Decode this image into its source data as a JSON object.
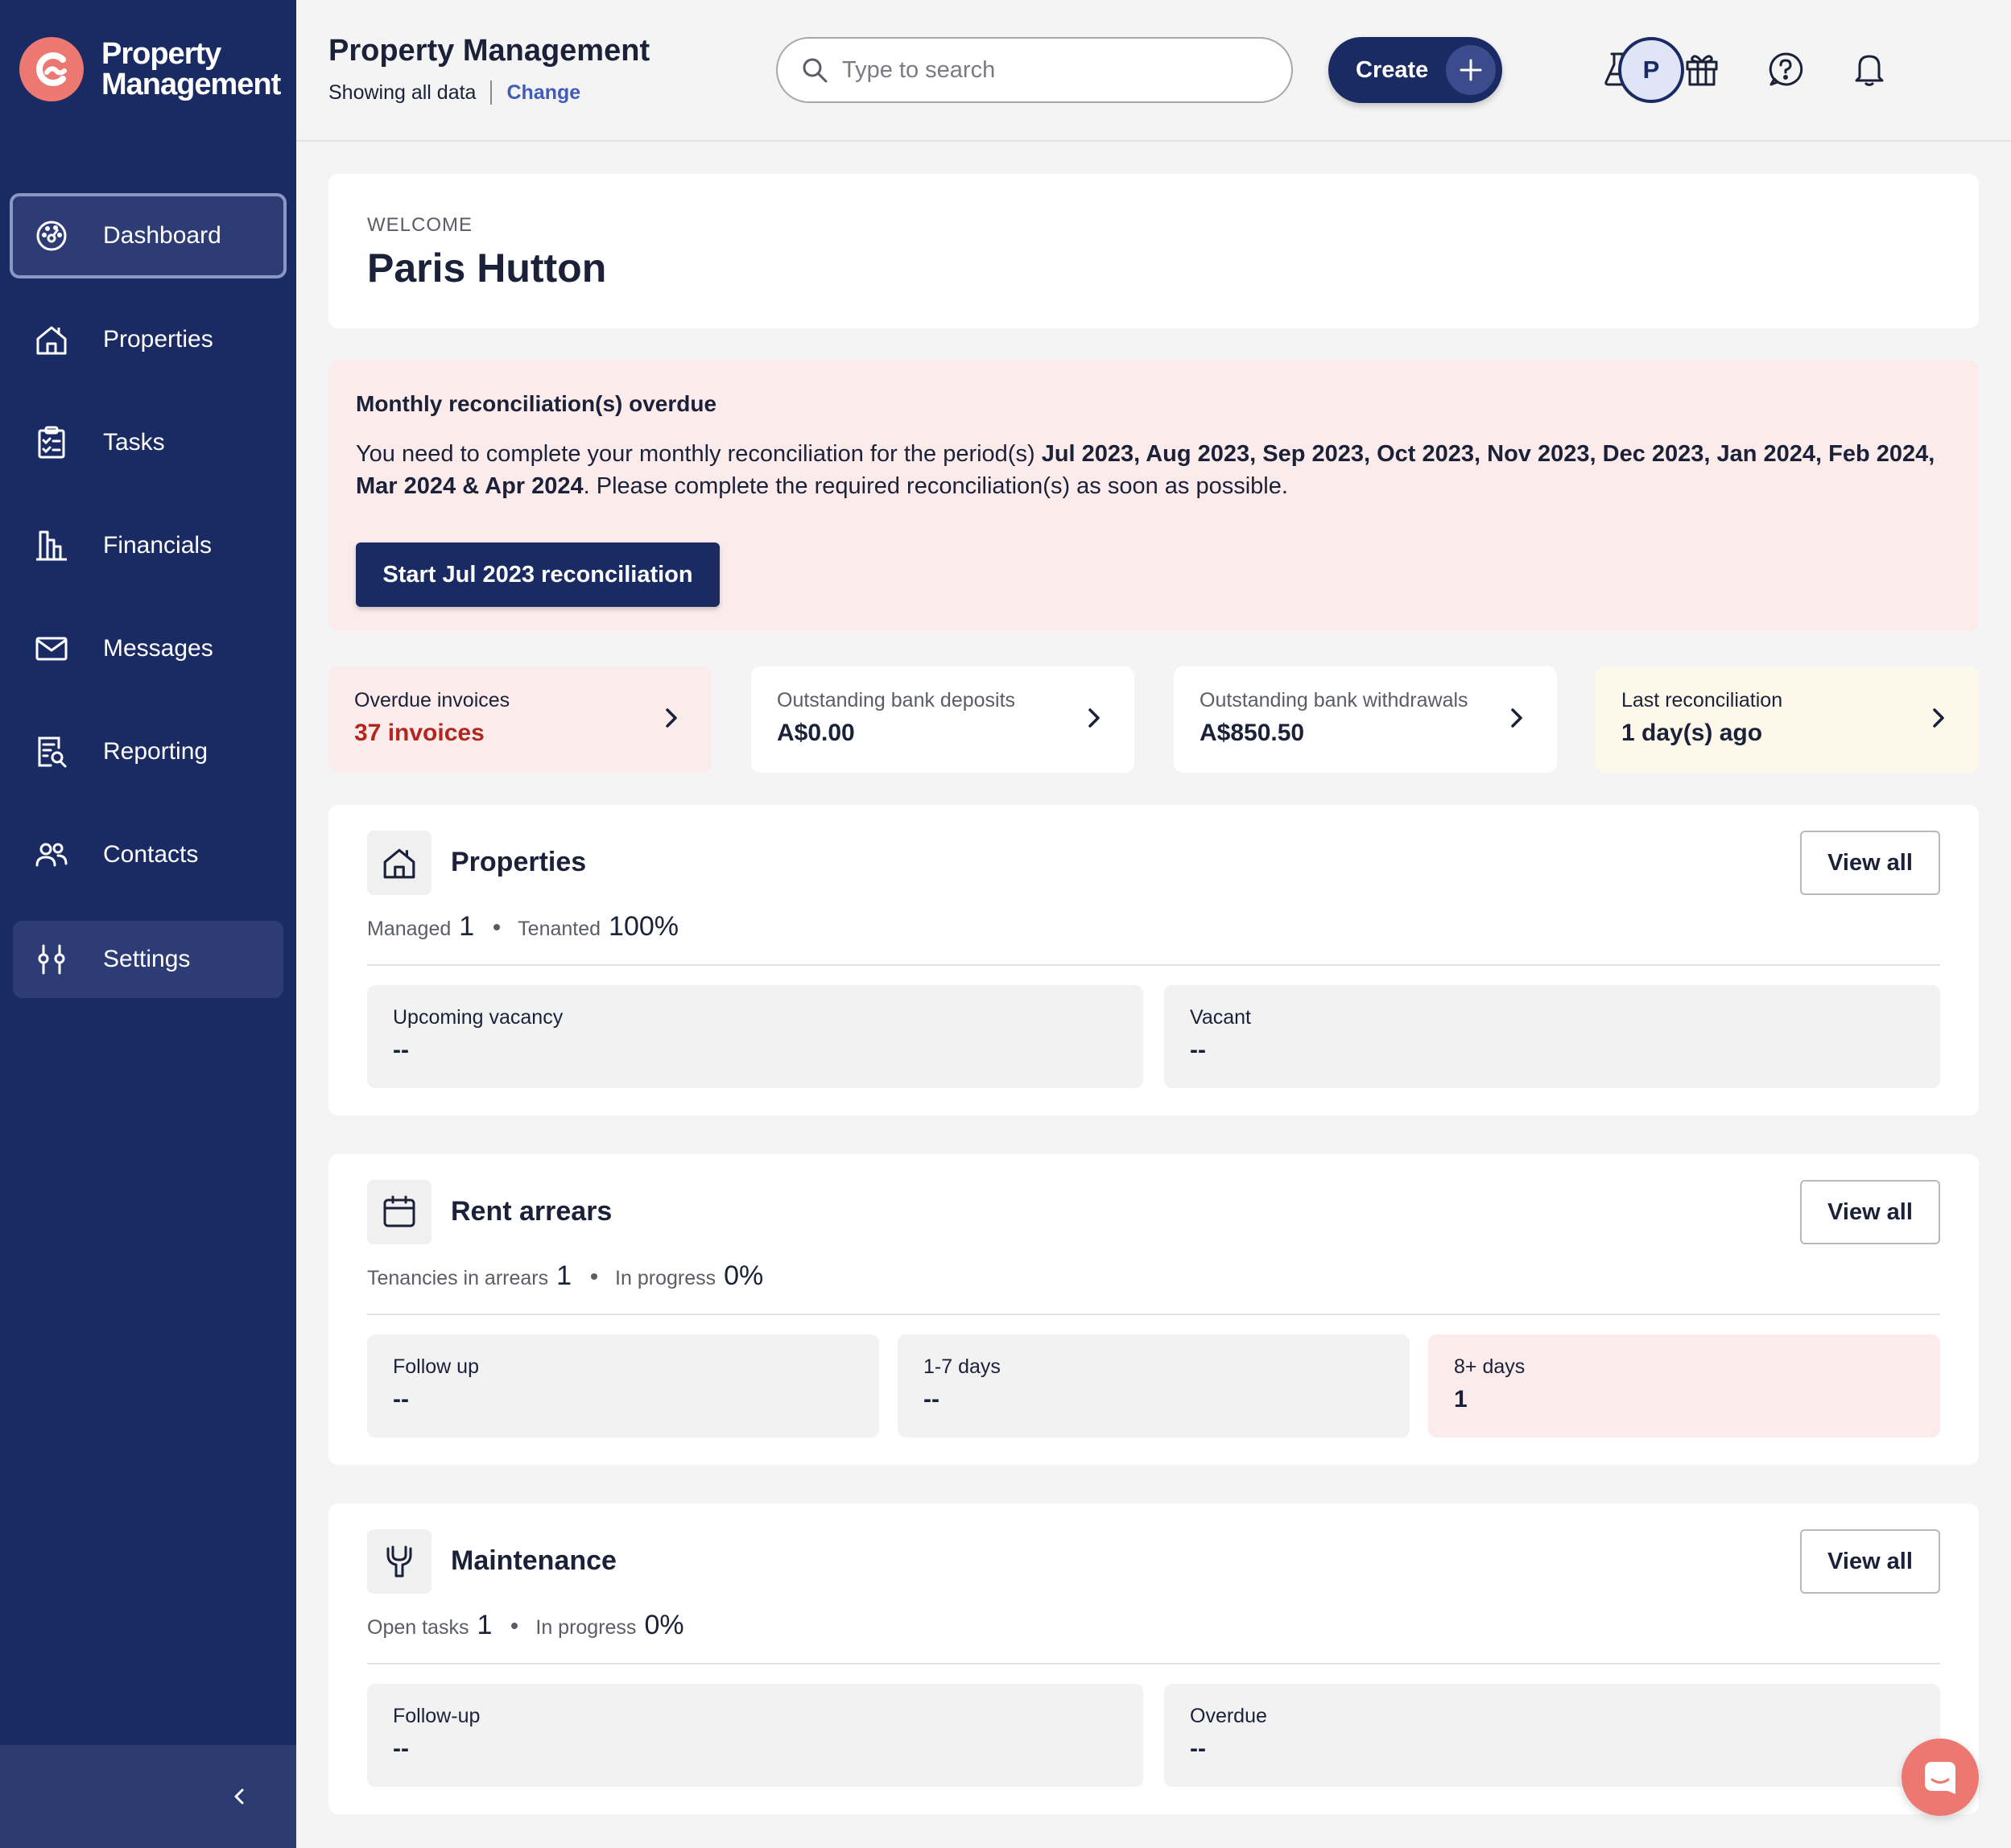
{
  "brand": {
    "line1": "Property",
    "line2": "Management"
  },
  "sidebar": {
    "items": [
      {
        "label": "Dashboard",
        "icon": "dashboard-icon"
      },
      {
        "label": "Properties",
        "icon": "home-icon"
      },
      {
        "label": "Tasks",
        "icon": "clipboard-icon"
      },
      {
        "label": "Financials",
        "icon": "bar-chart-icon"
      },
      {
        "label": "Messages",
        "icon": "mail-icon"
      },
      {
        "label": "Reporting",
        "icon": "report-icon"
      },
      {
        "label": "Contacts",
        "icon": "users-icon"
      },
      {
        "label": "Settings",
        "icon": "sliders-icon"
      }
    ],
    "active": "Dashboard",
    "hovered": "Settings"
  },
  "header": {
    "title": "Property Management",
    "subtitle": "Showing all data",
    "change_label": "Change",
    "search_placeholder": "Type to search",
    "create_label": "Create",
    "avatar_initial": "P",
    "icons": [
      "flask-icon",
      "gift-icon",
      "help-icon",
      "bell-icon"
    ]
  },
  "welcome": {
    "label": "WELCOME",
    "name": "Paris Hutton"
  },
  "alert": {
    "title": "Monthly reconciliation(s) overdue",
    "body_prefix": "You need to complete your monthly reconciliation for the period(s) ",
    "body_periods": "Jul 2023, Aug 2023, Sep 2023, Oct 2023, Nov 2023, Dec 2023, Jan 2024, Feb 2024, Mar 2024 & Apr 2024",
    "body_suffix": ". Please complete the required reconciliation(s) as soon as possible.",
    "button_label": "Start Jul 2023 reconciliation"
  },
  "stats": [
    {
      "label": "Overdue invoices",
      "value": "37 invoices"
    },
    {
      "label": "Outstanding bank deposits",
      "value": "A$0.00"
    },
    {
      "label": "Outstanding bank withdrawals",
      "value": "A$850.50"
    },
    {
      "label": "Last reconciliation",
      "value": "1 day(s) ago"
    }
  ],
  "properties": {
    "title": "Properties",
    "view_all": "View all",
    "metric1_label": "Managed",
    "metric1_value": "1",
    "metric2_label": "Tenanted",
    "metric2_value": "100%",
    "tiles": [
      {
        "label": "Upcoming vacancy",
        "value": "--"
      },
      {
        "label": "Vacant",
        "value": "--"
      }
    ]
  },
  "rent_arrears": {
    "title": "Rent arrears",
    "view_all": "View all",
    "metric1_label": "Tenancies in arrears",
    "metric1_value": "1",
    "metric2_label": "In progress",
    "metric2_value": "0%",
    "tiles": [
      {
        "label": "Follow up",
        "value": "--"
      },
      {
        "label": "1-7 days",
        "value": "--"
      },
      {
        "label": "8+ days",
        "value": "1"
      }
    ]
  },
  "maintenance": {
    "title": "Maintenance",
    "view_all": "View all",
    "metric1_label": "Open tasks",
    "metric1_value": "1",
    "metric2_label": "In progress",
    "metric2_value": "0%",
    "tiles": [
      {
        "label": "Follow-up",
        "value": "--"
      },
      {
        "label": "Overdue",
        "value": "--"
      }
    ]
  },
  "colors": {
    "sidebar": "#1a2b63",
    "accent_coral": "#ec7871",
    "alert_bg": "#fbeceb",
    "danger_text": "#b3261e",
    "link": "#3e5cb8"
  }
}
